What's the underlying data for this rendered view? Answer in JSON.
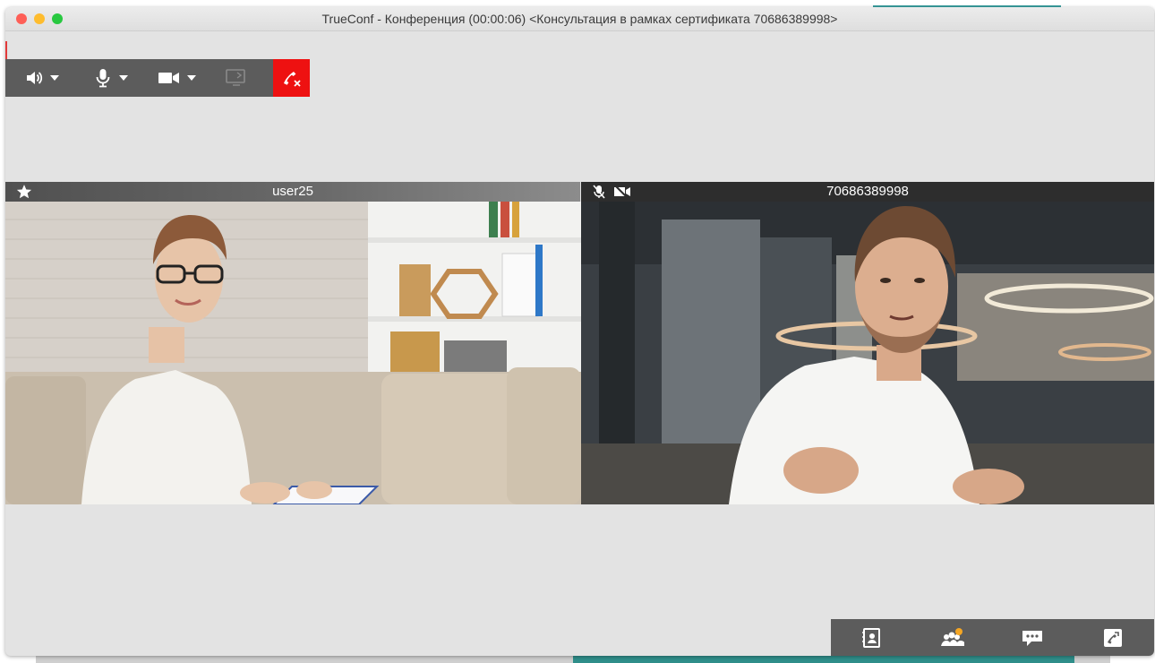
{
  "window": {
    "title": "TrueConf - Конференция (00:00:06) <Консультация в рамках сертификата 70686389998>"
  },
  "toolbar": {
    "icons": [
      "speaker-icon",
      "microphone-icon",
      "camera-icon",
      "screen-share-icon",
      "hangup-icon"
    ]
  },
  "participants": [
    {
      "name": "user25",
      "badge": "star-icon"
    },
    {
      "name": "70686389998",
      "status_icons": [
        "mic-muted-icon",
        "camera-off-icon"
      ]
    }
  ],
  "bottom_bar": {
    "icons": [
      "contacts-icon",
      "participants-icon",
      "chat-icon",
      "call-icon"
    ]
  },
  "colors": {
    "hangup": "#ee1111",
    "toolbar": "#5c5c5c",
    "notification_dot": "#f5a623"
  }
}
